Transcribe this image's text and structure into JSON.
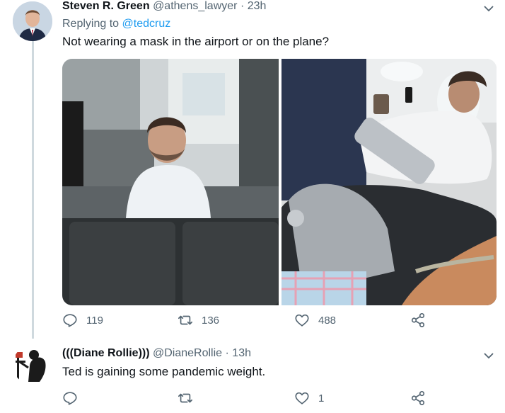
{
  "tweet": {
    "display_name": "Steven R. Green",
    "handle": "@athens_lawyer",
    "separator": "·",
    "time": "23h",
    "replying_prefix": "Replying to",
    "replying_to": "@tedcruz",
    "text": "Not wearing a mask in the airport or on the plane?",
    "replies": "119",
    "retweets": "136",
    "likes": "488"
  },
  "reply": {
    "display_name": "(((Diane Rollie)))",
    "handle": "@DianeRollie",
    "separator": "·",
    "time": "13h",
    "text": "Ted is gaining some pandemic weight.",
    "likes": "1"
  },
  "icons": [
    "chevron-down-icon",
    "reply-icon",
    "retweet-icon",
    "like-icon",
    "share-icon"
  ],
  "colors": {
    "accent": "#1d9bf0",
    "muted": "#536471",
    "thread": "#cfd9de"
  }
}
